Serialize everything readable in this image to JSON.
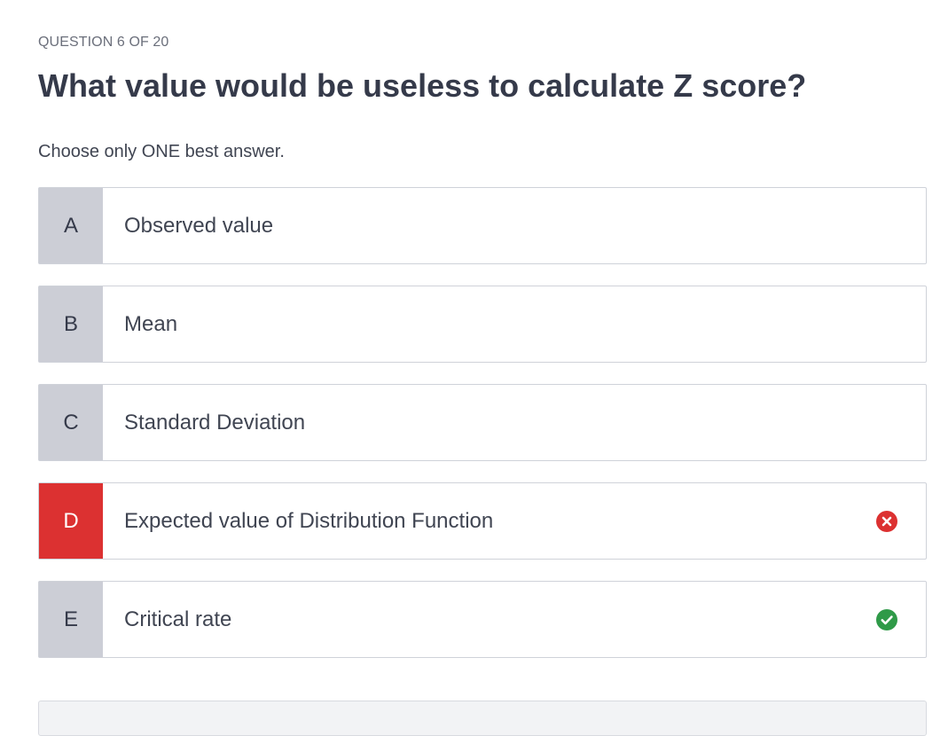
{
  "quiz": {
    "progress": "QUESTION 6 OF 20",
    "question": "What value would be useless to calculate Z score?",
    "instruction": "Choose only ONE best answer."
  },
  "options": [
    {
      "letter": "A",
      "text": "Observed value",
      "state": "default"
    },
    {
      "letter": "B",
      "text": "Mean",
      "state": "default"
    },
    {
      "letter": "C",
      "text": "Standard Deviation",
      "state": "default"
    },
    {
      "letter": "D",
      "text": "Expected value of Distribution Function",
      "state": "incorrect-selected",
      "icon": "close-circle-icon"
    },
    {
      "letter": "E",
      "text": "Critical rate",
      "state": "correct",
      "icon": "check-circle-icon"
    }
  ],
  "colors": {
    "incorrect": "#dc3131",
    "correct": "#2f9a48",
    "letter_bg": "#ccced6"
  }
}
